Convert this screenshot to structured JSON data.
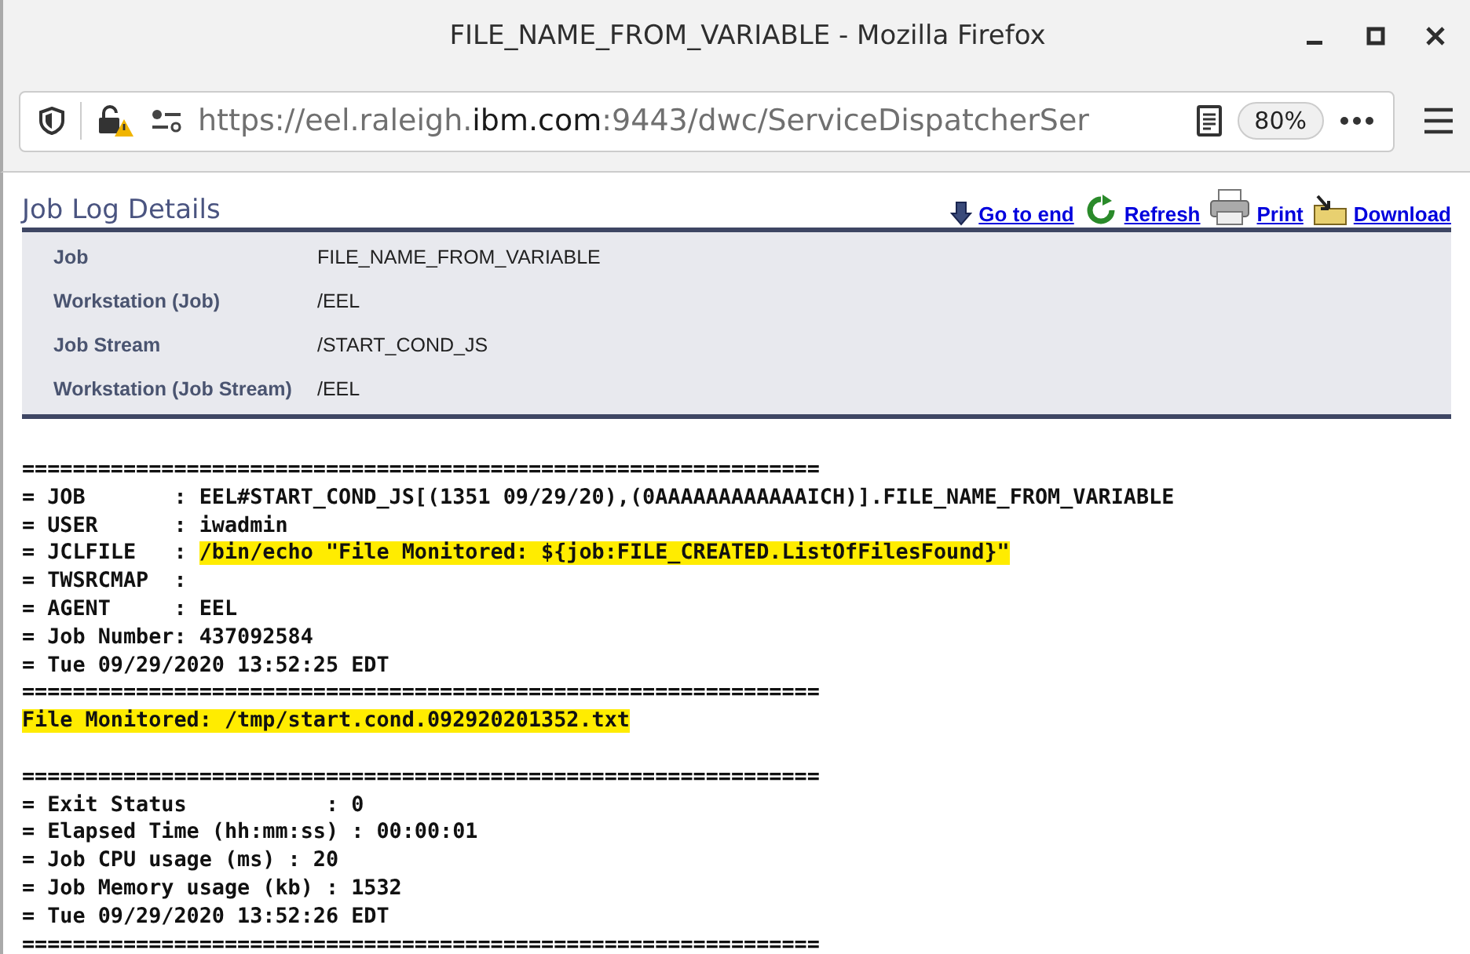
{
  "window": {
    "title": "FILE_NAME_FROM_VARIABLE - Mozilla Firefox"
  },
  "url_bar": {
    "url_parts": [
      {
        "text": "https://eel.raleigh.",
        "kind": "dim"
      },
      {
        "text": "ibm.com",
        "kind": "domain"
      },
      {
        "text": ":9443/dwc/ServiceDispatcherSer",
        "kind": "dim"
      }
    ],
    "zoom": "80%"
  },
  "page": {
    "title": "Job Log Details",
    "actions": [
      {
        "label": "Go to end",
        "kind": "down"
      },
      {
        "label": "Refresh",
        "kind": "refresh"
      },
      {
        "label": "Print",
        "kind": "print"
      },
      {
        "label": "Download",
        "kind": "download"
      }
    ],
    "details": [
      {
        "label": "Job",
        "value": "FILE_NAME_FROM_VARIABLE"
      },
      {
        "label": "Workstation (Job)",
        "value": "/EEL"
      },
      {
        "label": "Job Stream",
        "value": "/START_COND_JS"
      },
      {
        "label": "Workstation (Job Stream)",
        "value": "/EEL"
      }
    ],
    "log": [
      {
        "segments": [
          {
            "text": "===============================================================",
            "highlighted": false
          }
        ]
      },
      {
        "segments": [
          {
            "text": "= JOB       : EEL#START_COND_JS[(1351 09/29/20),(0AAAAAAAAAAAAICH)].FILE_NAME_FROM_VARIABLE",
            "highlighted": false
          }
        ]
      },
      {
        "segments": [
          {
            "text": "= USER      : iwadmin",
            "highlighted": false
          }
        ]
      },
      {
        "segments": [
          {
            "text": "= JCLFILE   : ",
            "highlighted": false
          },
          {
            "text": "/bin/echo \"File Monitored: ${job:FILE_CREATED.ListOfFilesFound}\"",
            "highlighted": true
          }
        ]
      },
      {
        "segments": [
          {
            "text": "= TWSRCMAP  :",
            "highlighted": false
          }
        ]
      },
      {
        "segments": [
          {
            "text": "= AGENT     : EEL",
            "highlighted": false
          }
        ]
      },
      {
        "segments": [
          {
            "text": "= Job Number: 437092584",
            "highlighted": false
          }
        ]
      },
      {
        "segments": [
          {
            "text": "= Tue 09/29/2020 13:52:25 EDT",
            "highlighted": false
          }
        ]
      },
      {
        "segments": [
          {
            "text": "===============================================================",
            "highlighted": false
          }
        ]
      },
      {
        "segments": [
          {
            "text": "File Monitored: /tmp/start.cond.092920201352.txt",
            "highlighted": true
          }
        ]
      },
      {
        "kind": "blank"
      },
      {
        "segments": [
          {
            "text": "===============================================================",
            "highlighted": false
          }
        ]
      },
      {
        "segments": [
          {
            "text": "= Exit Status           : 0",
            "highlighted": false
          }
        ]
      },
      {
        "segments": [
          {
            "text": "= Elapsed Time (hh:mm:ss) : 00:00:01",
            "highlighted": false
          }
        ]
      },
      {
        "segments": [
          {
            "text": "= Job CPU usage (ms) : 20",
            "highlighted": false
          }
        ]
      },
      {
        "segments": [
          {
            "text": "= Job Memory usage (kb) : 1532",
            "highlighted": false
          }
        ]
      },
      {
        "segments": [
          {
            "text": "= Tue 09/29/2020 13:52:26 EDT",
            "highlighted": false
          }
        ]
      },
      {
        "segments": [
          {
            "text": "===============================================================",
            "highlighted": false
          }
        ]
      }
    ]
  }
}
